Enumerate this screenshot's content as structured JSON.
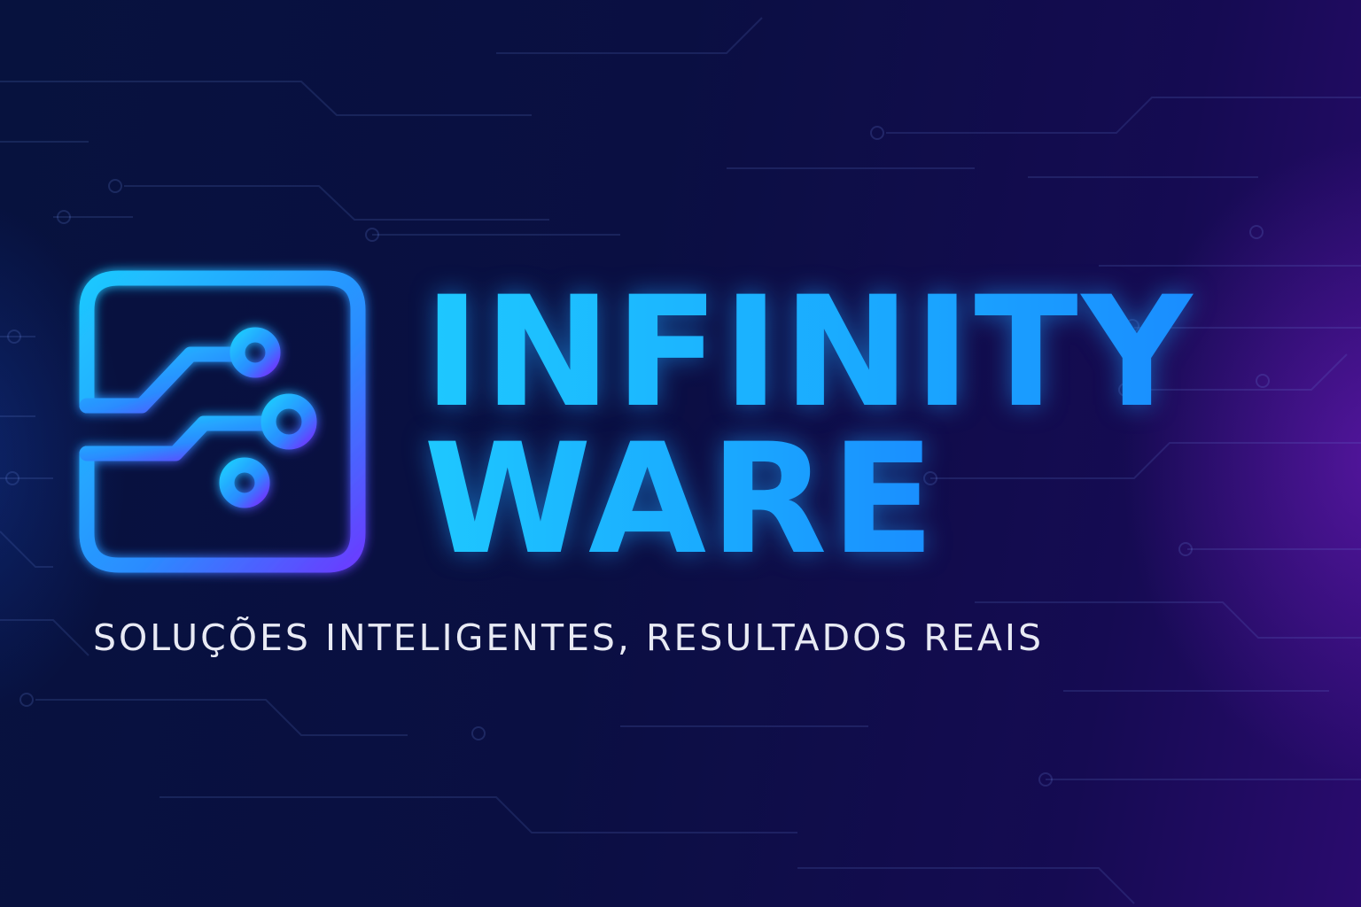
{
  "brand": {
    "name_line_1": "INFINITY",
    "name_line_2": "WARE",
    "tagline": "SOLUÇÕES INTELIGENTES, RESULTADOS REAIS"
  },
  "icons": {
    "logo": "circuit-board-icon"
  },
  "colors": {
    "background_dark": "#07123e",
    "background_purple": "#2a0b6e",
    "brand_cyan": "#19b4ff",
    "brand_violet": "#6a3cff",
    "tagline_text": "#e8eaf4"
  }
}
